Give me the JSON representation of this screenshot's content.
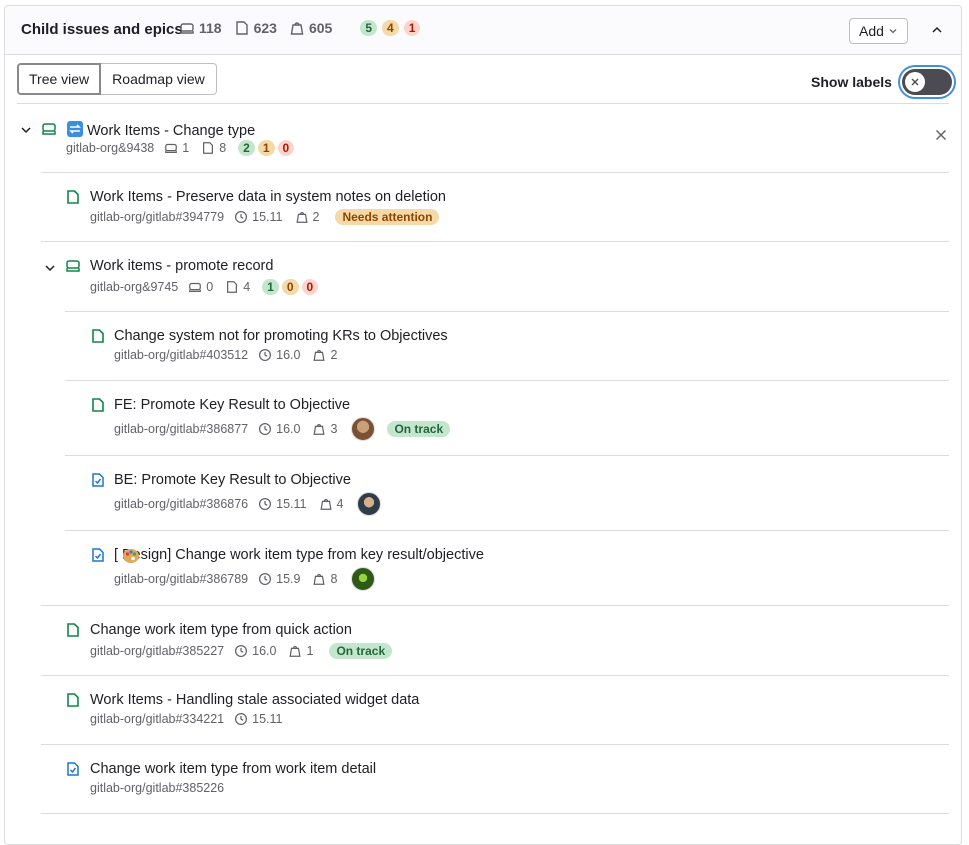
{
  "header": {
    "title": "Child issues and epics",
    "epic_count": "118",
    "issue_count": "623",
    "weight_count": "605",
    "health": {
      "on_track": "5",
      "needs_attention": "4",
      "at_risk": "1"
    },
    "add_label": "Add"
  },
  "views": {
    "tree": "Tree view",
    "roadmap": "Roadmap view"
  },
  "labels_toggle": {
    "label": "Show labels"
  },
  "items": [
    {
      "title": "Work Items - Change type",
      "ref": "gitlab-org&9438",
      "epics": "1",
      "issues": "8",
      "health": [
        "2",
        "1",
        "0"
      ]
    },
    {
      "title": "Work Items - Preserve data in system notes on deletion",
      "ref": "gitlab-org/gitlab#394779",
      "milestone": "15.11",
      "weight": "2",
      "status": "Needs attention"
    },
    {
      "title": "Work items - promote record",
      "ref": "gitlab-org&9745",
      "epics": "0",
      "issues": "4",
      "health": [
        "1",
        "0",
        "0"
      ]
    },
    {
      "title": "Change system not for promoting KRs to Objectives",
      "ref": "gitlab-org/gitlab#403512",
      "milestone": "16.0",
      "weight": "2"
    },
    {
      "title": "FE: Promote Key Result to Objective",
      "ref": "gitlab-org/gitlab#386877",
      "milestone": "16.0",
      "weight": "3",
      "status": "On track"
    },
    {
      "title": "BE: Promote Key Result to Objective",
      "ref": "gitlab-org/gitlab#386876",
      "milestone": "15.11",
      "weight": "4"
    },
    {
      "title": "[ Design] Change work item type from key result/objective",
      "ref": "gitlab-org/gitlab#386789",
      "milestone": "15.9",
      "weight": "8"
    },
    {
      "title": "Change work item type from quick action",
      "ref": "gitlab-org/gitlab#385227",
      "milestone": "16.0",
      "weight": "1",
      "status": "On track"
    },
    {
      "title": "Work Items - Handling stale associated widget data",
      "ref": "gitlab-org/gitlab#334221",
      "milestone": "15.11"
    },
    {
      "title": "Change work item type from work item detail",
      "ref": "gitlab-org/gitlab#385226"
    }
  ],
  "colors": {
    "issue_green": "#108548",
    "task_blue": "#1f75cb",
    "toggle_focus": "#428fdc"
  }
}
